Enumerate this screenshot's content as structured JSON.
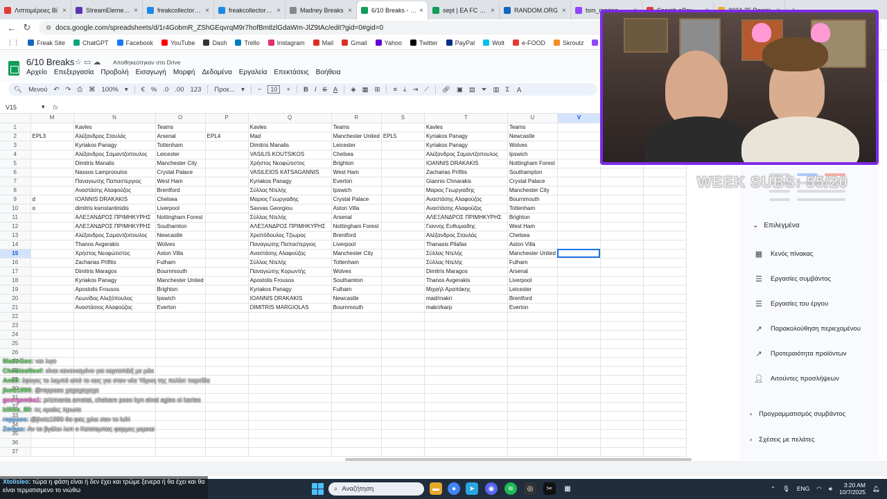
{
  "browser": {
    "tabs": [
      {
        "label": "Λιπτομέρειες Βί",
        "color": "#e53935",
        "active": false
      },
      {
        "label": "StreamElements",
        "color": "#5e35b1",
        "active": false
      },
      {
        "label": "freakcollectors.co",
        "color": "#1e88e5",
        "active": false
      },
      {
        "label": "freakcollectors.co",
        "color": "#1e88e5",
        "active": false
      },
      {
        "label": "Madney Breaks",
        "color": "#888888",
        "active": false
      },
      {
        "label": "6/10 Breaks - Υπ",
        "color": "#0f9d58",
        "active": true
      },
      {
        "label": "sept | EA FC 26 C",
        "color": "#0f9d58",
        "active": false
      },
      {
        "label": "RANDOM.ORG",
        "color": "#1565c0",
        "active": false
      },
      {
        "label": "tsm_mariaa - Tw",
        "color": "#9146ff",
        "active": false
      },
      {
        "label": "Search eBay Sale",
        "color": "#e53935",
        "active": false
      },
      {
        "label": "2024-25 Panini",
        "color": "#f9a825",
        "active": false
      }
    ],
    "url": "docs.google.com/spreadsheets/d/1r4GobmR_ZShGEqvrqM9r7hofBmtlzlGdaWm-JlZ9tAc/edit?gid=0#gid=0",
    "bookmarks": [
      {
        "label": "Freak Site",
        "color": "#1565c0"
      },
      {
        "label": "ChatGPT",
        "color": "#10a37f"
      },
      {
        "label": "Facebook",
        "color": "#1877f2"
      },
      {
        "label": "YouTube",
        "color": "#ff0000"
      },
      {
        "label": "Dash",
        "color": "#333333"
      },
      {
        "label": "Trello",
        "color": "#0079bf"
      },
      {
        "label": "Instagram",
        "color": "#e1306c"
      },
      {
        "label": "Mail",
        "color": "#d93025"
      },
      {
        "label": "Gmail",
        "color": "#d93025"
      },
      {
        "label": "Yahoo",
        "color": "#6001d2"
      },
      {
        "label": "Twitter",
        "color": "#000000"
      },
      {
        "label": "PayPal",
        "color": "#003087"
      },
      {
        "label": "Wolt",
        "color": "#00c2e8"
      },
      {
        "label": "e-FOOD",
        "color": "#e53935"
      },
      {
        "label": "Skroutz",
        "color": "#f68b24"
      },
      {
        "label": "Twitch",
        "color": "#9146ff"
      },
      {
        "label": "Kick",
        "color": "#53fc18"
      }
    ]
  },
  "sheet": {
    "title": "6/10 Breaks",
    "saved_status": "Αποθηκεύτηκαν στο Drive",
    "menu": [
      "Αρχείο",
      "Επεξεργασία",
      "Προβολή",
      "Εισαγωγή",
      "Μορφή",
      "Δεδομένα",
      "Εργαλεία",
      "Επεκτάσεις",
      "Βοήθεια"
    ],
    "toolbar": {
      "search": "Μενού",
      "zoom": "100%",
      "currency": "€",
      "percent": "%",
      "decimals_dec": ".0",
      "decimals_inc": ".00",
      "format": "123",
      "font": "Προε...",
      "font_size": "10"
    },
    "namebox": "V15",
    "fx": "fx",
    "columns": [
      "M",
      "N",
      "O",
      "P",
      "Q",
      "R",
      "S",
      "T",
      "U",
      "V",
      "",
      ""
    ],
    "selected_col": "V",
    "selected_row": "15",
    "row_numbers": [
      "1",
      "2",
      "3",
      "4",
      "5",
      "6",
      "7",
      "8",
      "9",
      "10",
      "11",
      "12",
      "13",
      "14",
      "15",
      "16",
      "17",
      "18",
      "19",
      "20",
      "21",
      "22",
      "23",
      "24",
      "25",
      "26",
      "27",
      "28",
      "29",
      "30",
      "31",
      "32",
      "33",
      "34",
      "35",
      "36",
      "37"
    ],
    "rows": [
      [
        "",
        "Kavles",
        "Teams",
        "",
        "Kavles",
        "Teams",
        "",
        "Kavles",
        "Teams",
        ""
      ],
      [
        "EPL3",
        "Αλέξανδρος Σταυλάς",
        "Arsenal",
        "EPL4",
        "Mad",
        "Manchester United",
        "EPL5",
        "Kyriakos Panagy",
        "Newcastle",
        ""
      ],
      [
        "",
        "Kyriakos Panagy",
        "Tottenham",
        "",
        "Dimitris Manalis",
        "Leicester",
        "",
        "Kyriakos Panagy",
        "Wolves",
        ""
      ],
      [
        "",
        "Αλέξανδρος Σαμαντζοπουλος",
        "Leicester",
        "",
        "VASILIS KOUTSIKOS",
        "Chelsea",
        "",
        "Αλέξανδρος Σαμαντζοπουλος",
        "Ipswich",
        ""
      ],
      [
        "",
        "Dimitris Manalis",
        "Manchester City",
        "",
        "Χρήστος Νεοφώτιστος",
        "Brighton",
        "",
        "IOANNIS DRAKAKIS",
        "Nottingham Forest",
        ""
      ],
      [
        "",
        "Nassos Lamprooulos",
        "Crystal Palace",
        "",
        "VASILEIOS KATSAGANNIS",
        "West Ham",
        "",
        "Zacharias Prifitis",
        "Southampton",
        ""
      ],
      [
        "",
        "Παναγιωτης Παπαστεργιος",
        "West Ham",
        "",
        "Kyriakos Panagy",
        "Everton",
        "",
        "Giannis Chnarakis",
        "Crystal Palace",
        ""
      ],
      [
        "",
        "Αναστάσης Αλαφούζος",
        "Brentford",
        "",
        "Σύλλας Ντελής",
        "Ipswich",
        "",
        "Μαριος Γεωργιαδης",
        "Manchester City",
        ""
      ],
      [
        "d",
        "IOANNIS DRAKAKIS",
        "Chelsea",
        "",
        "Μαριος Γεωργιαδης",
        "Crystal Palace",
        "",
        "Αναστάσης Αλαφούζος",
        "Bournmouth",
        ""
      ],
      [
        "o",
        "dimitris kwnstantinidis",
        "Liverpool",
        "",
        "Savvas Georgiou",
        "Aston Villa",
        "",
        "Αναστάσης Αλαφούζος",
        "Tottenham",
        ""
      ],
      [
        "",
        "ΑΛΕΞΑΝΔΡΟΣ ΠΡΙΜΗΚΥΡΗΣ",
        "Nottingham Forest",
        "",
        "Σύλλας Ντελής",
        "Arsenal",
        "",
        "ΑΛΕΞΑΝΔΡΟΣ ΠΡΙΜΗΚΥΡΗΣ",
        "Brighton",
        ""
      ],
      [
        "",
        "ΑΛΕΞΑΝΔΡΟΣ ΠΡΙΜΗΚΥΡΗΣ",
        "Southamton",
        "",
        "ΑΛΕΞΑΝΔΡΟΣ ΠΡΙΜΗΚΥΡΗΣ",
        "Nottingham Forest",
        "",
        "Γιαννης Ευθυμιαδης",
        "West Ham",
        ""
      ],
      [
        "",
        "Αλέξανδρος Σαμαντζοπουλος",
        "Newcastle",
        "",
        "Χριστόδουλος Τζιωρος",
        "Brentford",
        "",
        "Αλέξανδρος Σταυλάς",
        "Chelsea",
        ""
      ],
      [
        "",
        "Thanos Avgerakis",
        "Wolves",
        "",
        "Παναγιωτης Παπαστεργιος",
        "Liverpool",
        "",
        "Thanasis Pilafas",
        "Aston Villa",
        ""
      ],
      [
        "",
        "Χρήστος Νεοφώτιστος",
        "Aston Villa",
        "",
        "Αναστάσης Αλαφούζος",
        "Manchester City",
        "",
        "Σύλλας Ντελής",
        "Manchester United",
        ""
      ],
      [
        "",
        "Zacharias Prifitis",
        "Fulham",
        "",
        "Σύλλας Ντελής",
        "Tottenham",
        "",
        "Σύλλας Ντελής",
        "Fulham",
        ""
      ],
      [
        "",
        "Dimitris Maragos",
        "Bournmouth",
        "",
        "Παναγιώτης Κορωντής",
        "Wolves",
        "",
        "Dimitris Maragos",
        "Arsenal",
        ""
      ],
      [
        "",
        "Kyriakos Panagy",
        "Manchester United",
        "",
        "Apostolis Frousos",
        "Southamton",
        "",
        "Thanos Avgerakis",
        "Liverpool",
        ""
      ],
      [
        "",
        "Apostolis Frousos",
        "Brighton",
        "",
        "Kyriakos Panagy",
        "Fulham",
        "",
        "Μιχαήλ Αραπάκης",
        "Leicester",
        ""
      ],
      [
        "",
        "Λεωνίδας Αλεξόπουλος",
        "Ipswich",
        "",
        "IOANNIS DRAKAKIS",
        "Newcastle",
        "",
        "mad/makri",
        "Brentford",
        ""
      ],
      [
        "",
        "Αναστάσιος Αλαφούζος",
        "Everton",
        "",
        "DIMITRIS MARGIOLAS",
        "Bournmouth",
        "",
        "makri/karp",
        "Everton",
        ""
      ]
    ]
  },
  "side_panel": {
    "templates_heading": "Επιλεγμένα",
    "templates": [
      {
        "label": "Κενός πίνακας",
        "icon": "table-icon"
      },
      {
        "label": "Εργασίες συμβάντος",
        "icon": "checklist-icon"
      },
      {
        "label": "Εργασίες του έργου",
        "icon": "checklist-icon"
      },
      {
        "label": "Παρακολούθηση περιεχομένου",
        "icon": "trend-icon"
      },
      {
        "label": "Προτεραιότητα προϊόντων",
        "icon": "trend-icon"
      },
      {
        "label": "Αιτούντες προσλήψεων",
        "icon": "person-icon"
      }
    ],
    "groups": [
      {
        "label": "Προγραμματισμός συμβάντος"
      },
      {
        "label": "Σχέσεις με πελάτες"
      }
    ]
  },
  "stream": {
    "sub_goal": "WEEK SUBS: 55/20",
    "chat": [
      {
        "user": "MarioGeo:",
        "msg": "ναι λιγο",
        "color": "green"
      },
      {
        "user": "ChristosNeof:",
        "msg": "είναι κανονισμένο για καρτοπάιξ με μάκ",
        "color": "green"
      },
      {
        "user": "Antl3:",
        "msg": "έφυγες το λαμπό από το κεις για σταν νέα Υόρκη της πελίατ παρτίδα",
        "color": "green"
      },
      {
        "user": "jkotz1990:",
        "msg": "@reppaes χαχαχαχαχα",
        "color": "green"
      },
      {
        "user": "georgemba1:",
        "msg": "prizmania arnetai, chekare poso kyn einai agies oi kartes",
        "color": "pink"
      },
      {
        "user": "killias_80:",
        "msg": "τις οραίες πρωτα",
        "color": "green"
      },
      {
        "user": "reppaes:",
        "msg": "@jkotz1990 θα φας χιλιε σαν το lufri",
        "color": "blue"
      },
      {
        "user": "Zorbas:",
        "msg": "Αν τα βγάλει λεπ ο Κατσαμπας φαρμες μερικα",
        "color": "blue"
      }
    ],
    "banner_user": "Xtolisleo:",
    "banner_msg": "τώρα η φάση είναι ή δεν έχει και τρώμε ξενερα ή θα έχει και θα είναι τερματισμενο το νιώθω"
  },
  "taskbar": {
    "search": "Αναζήτηση",
    "lang": "ENG",
    "time": "3:20 AM",
    "date": "10/7/2025"
  }
}
